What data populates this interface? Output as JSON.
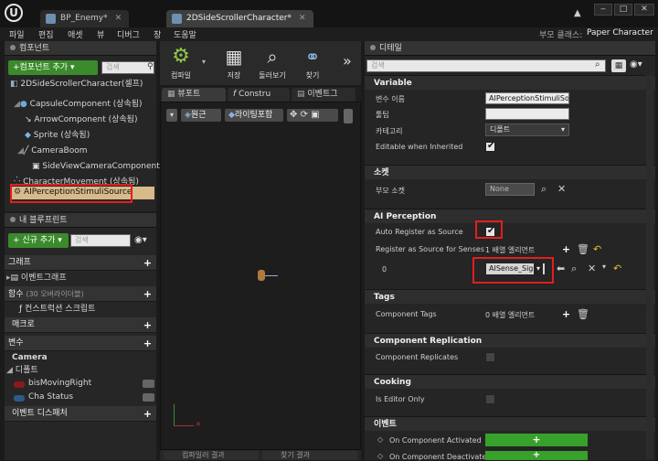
{
  "titlebar": {
    "tabs": [
      {
        "label": "BP_Enemy*"
      },
      {
        "label": "2DSideScrollerCharacter*"
      }
    ],
    "logo": "U"
  },
  "menu": {
    "items": [
      "파일",
      "편집",
      "애셋",
      "뷰",
      "디버그",
      "창",
      "도움말"
    ],
    "parent_class_label": "부모 클래스:",
    "parent_class_value": "Paper Character"
  },
  "components": {
    "header": "컴포넌트",
    "add_button": "+컴포넌트 추가 ▾",
    "search_placeholder": "검색",
    "items": [
      "2DSideScrollerCharacter(셀프)",
      "CapsuleComponent (상속됨)",
      "ArrowComponent (상속됨)",
      "Sprite (상속됨)",
      "CameraBoom",
      "SideViewCameraComponent",
      "CharacterMovement (상속됨)",
      "AIPerceptionStimuliSource"
    ]
  },
  "blueprint": {
    "header": "내 블루프린트",
    "new_button": "+ 신규 추가 ▾",
    "search_placeholder": "검색",
    "graph": "그래프",
    "event_graph": "이벤트그래프",
    "functions": "함수",
    "functions_note": "(30 오버라이더블)",
    "construction_script": "컨스트럭션 스크립트",
    "macro": "매크로",
    "variables": "변수",
    "var_camera": "Camera",
    "var_default": "디폴트",
    "var_items": [
      "bisMovingRight",
      "Cha Status"
    ],
    "event_dispatcher": "이벤트 디스패처"
  },
  "toolbar": {
    "compile": "컴파일",
    "save": "저장",
    "browse": "둘러보기",
    "find": "찾기",
    "more": "»"
  },
  "viewport": {
    "tabs": [
      "뷰포트",
      "Constru",
      "이벤트그"
    ],
    "perspective": "원근",
    "lit": "라이팅포함",
    "bottom_tabs": [
      "컴파일러 결과",
      "찾기 결과"
    ]
  },
  "details": {
    "header": "디테일",
    "search_placeholder": "검색",
    "variable_section": "Variable",
    "var_name_label": "변수 이름",
    "var_name_value": "AIPerceptionStimuliSou",
    "tooltip_label": "툴팁",
    "tooltip_value": "",
    "category_label": "카테고리",
    "category_value": "디폴트",
    "editable_label": "Editable when Inherited",
    "socket_section": "소켓",
    "parent_socket_label": "부모 소켓",
    "parent_socket_value": "None",
    "ai_section": "AI Perception",
    "auto_register_label": "Auto Register as Source",
    "register_senses_label": "Register as Source for Senses",
    "register_senses_value": "1 배열 엘리먼트",
    "sense_index": "0",
    "sense_value": "AISense_Sight",
    "tags_section": "Tags",
    "component_tags_label": "Component Tags",
    "component_tags_value": "0 배열 엘리먼트",
    "replication_section": "Component Replication",
    "replicates_label": "Component Replicates",
    "cooking_section": "Cooking",
    "editor_only_label": "Is Editor Only",
    "events_section": "이벤트",
    "event_activated": "On Component Activated",
    "event_deactivated": "On Component Deactivated"
  },
  "colors": {
    "green_button": "#3b8a2c",
    "highlight_red": "#e21e1e",
    "event_green": "#37a12b"
  }
}
